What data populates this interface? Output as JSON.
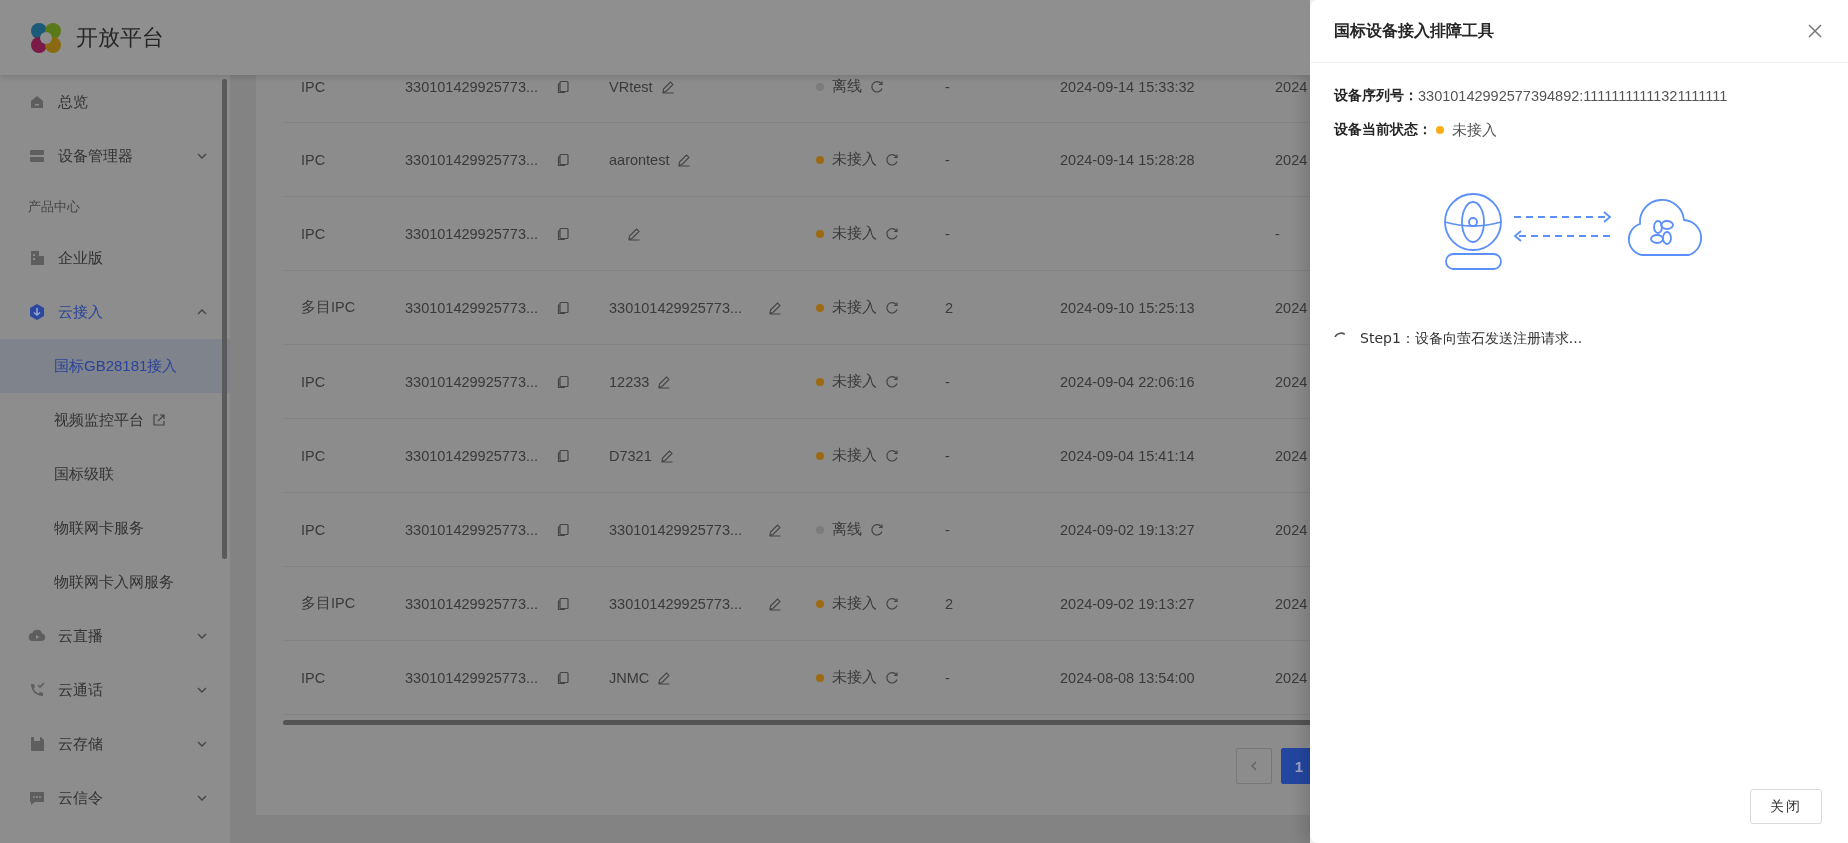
{
  "brand": {
    "name": "开放平台"
  },
  "sidebar": {
    "items": [
      {
        "kind": "item",
        "label": "总览",
        "selected": false
      },
      {
        "kind": "group",
        "label": "设备管理器",
        "selected": false,
        "expanded": false
      },
      {
        "kind": "section",
        "label": "产品中心"
      },
      {
        "kind": "item",
        "label": "企业版",
        "selected": false
      },
      {
        "kind": "group",
        "label": "云接入",
        "selected": true,
        "expanded": true,
        "children": [
          {
            "label": "国标GB28181接入",
            "selected": true,
            "external": false
          },
          {
            "label": "视频监控平台",
            "selected": false,
            "external": true
          },
          {
            "label": "国标级联",
            "selected": false,
            "external": false
          },
          {
            "label": "物联网卡服务",
            "selected": false,
            "external": false
          },
          {
            "label": "物联网卡入网服务",
            "selected": false,
            "external": false
          }
        ]
      },
      {
        "kind": "group",
        "label": "云直播",
        "selected": false,
        "expanded": false
      },
      {
        "kind": "group",
        "label": "云通话",
        "selected": false,
        "expanded": false
      },
      {
        "kind": "group",
        "label": "云存储",
        "selected": false,
        "expanded": false
      },
      {
        "kind": "group",
        "label": "云信令",
        "selected": false,
        "expanded": false
      }
    ]
  },
  "table": {
    "rows": [
      {
        "column_1": "IPC",
        "column_2": "330101429925773...",
        "column_3": "VRtest",
        "column_4": {
          "label": "离线",
          "color": "#7b7b7b"
        },
        "column_5": "-",
        "column_6": "2024-09-14 15:33:32",
        "column_7": "2024"
      },
      {
        "column_1": "IPC",
        "column_2": "330101429925773...",
        "column_3": "aarontest",
        "column_4": {
          "label": "未接入",
          "color": "#9c6a12"
        },
        "column_5": "-",
        "column_6": "2024-09-14 15:28:28",
        "column_7": "2024"
      },
      {
        "column_1": "IPC",
        "column_2": "330101429925773...",
        "column_4": {
          "label": "未接入",
          "color": "#9c6a12"
        },
        "column_5": "-",
        "column_7": "-"
      },
      {
        "column_1": "多目IPC",
        "column_2": "330101429925773...",
        "column_3": "330101429925773...",
        "column_4": {
          "label": "未接入",
          "color": "#9c6a12"
        },
        "column_5": "2",
        "column_6": "2024-09-10 15:25:13",
        "column_7": "2024"
      },
      {
        "column_1": "IPC",
        "column_2": "330101429925773...",
        "column_3": "12233",
        "column_4": {
          "label": "未接入",
          "color": "#9c6a12"
        },
        "column_5": "-",
        "column_6": "2024-09-04 22:06:16",
        "column_7": "2024"
      },
      {
        "column_1": "IPC",
        "column_2": "330101429925773...",
        "column_3": "D7321",
        "column_4": {
          "label": "未接入",
          "color": "#9c6a12"
        },
        "column_5": "-",
        "column_6": "2024-09-04 15:41:14",
        "column_7": "2024"
      },
      {
        "column_1": "IPC",
        "column_2": "330101429925773...",
        "column_3": "330101429925773...",
        "column_4": {
          "label": "离线",
          "color": "#7b7b7b"
        },
        "column_5": "-",
        "column_6": "2024-09-02 19:13:27",
        "column_7": "2024"
      },
      {
        "column_1": "多目IPC",
        "column_2": "330101429925773...",
        "column_3": "330101429925773...",
        "column_4": {
          "label": "未接入",
          "color": "#9c6a12"
        },
        "column_5": "2",
        "column_6": "2024-09-02 19:13:27",
        "column_7": "2024"
      },
      {
        "column_1": "IPC",
        "column_2": "330101429925773...",
        "column_3": "JNMC",
        "column_4": {
          "label": "未接入",
          "color": "#9c6a12"
        },
        "column_5": "-",
        "column_6": "2024-08-08 13:54:00",
        "column_7": "2024"
      }
    ]
  },
  "pagination": {
    "pages": [
      {
        "label": "1",
        "selected": true
      }
    ]
  },
  "drawer": {
    "title": "国标设备接入排障工具",
    "serial": {
      "label": "设备序列号：",
      "value": "33010142992577394892:11111111111321111111"
    },
    "status": {
      "label": "设备当前状态：",
      "value": "未接入",
      "color": "#faad14"
    },
    "steps": [
      {
        "kind": "loading",
        "label": "Step1：设备向萤石发送注册请求..."
      }
    ],
    "buttons": [
      "关闭"
    ]
  }
}
